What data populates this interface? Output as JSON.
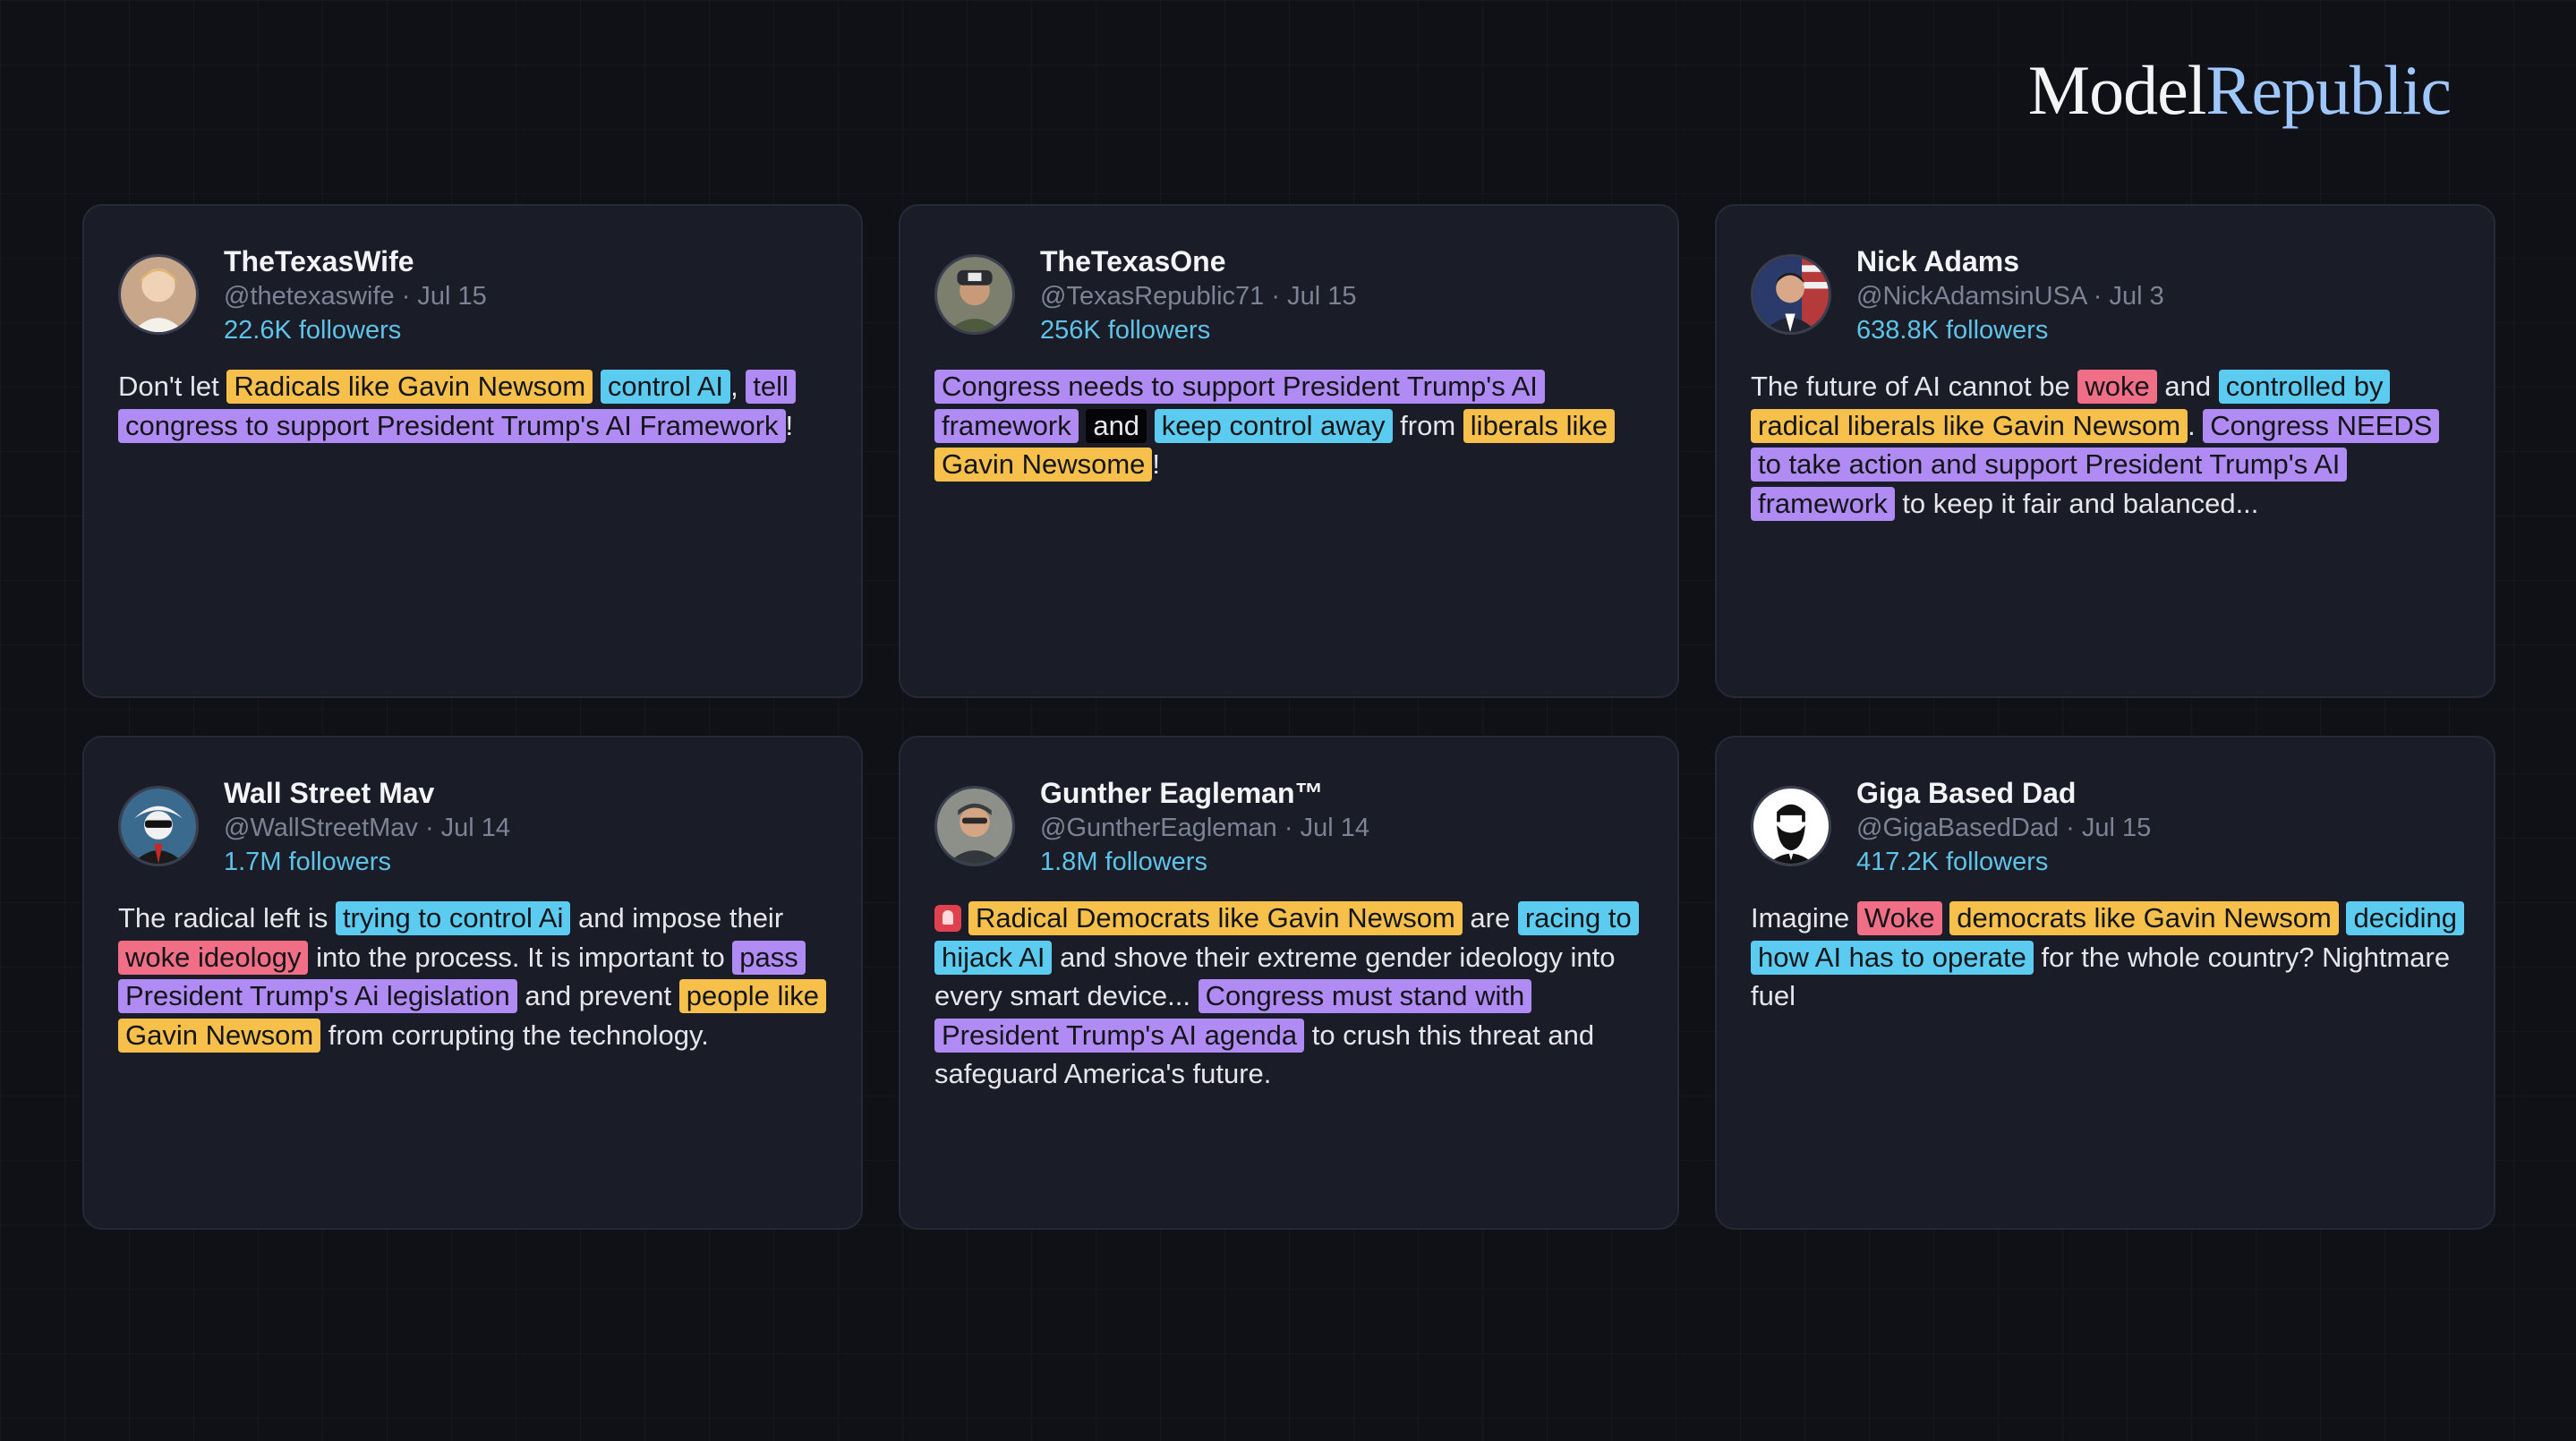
{
  "brand": {
    "part1": "Model",
    "part2": "Republic",
    "accent": "#9ec6ff"
  },
  "highlight_colors": {
    "yellow": "#f6c04a",
    "cyan": "#5ccbf0",
    "purple": "#b08bf3",
    "red": "#f06f86",
    "black": "#050507"
  },
  "posts": [
    {
      "name": "TheTexasWife",
      "handle_date": "@thetexaswife · Jul 15",
      "followers": "22.6K followers",
      "avatar_icon": "user-photo-icon",
      "segments": [
        {
          "text": "Don't let "
        },
        {
          "text": "Radicals like Gavin Newsom",
          "hl": "yellow"
        },
        {
          "text": " "
        },
        {
          "text": "control AI",
          "hl": "cyan"
        },
        {
          "text": ", "
        },
        {
          "text": "tell congress to support President Trump's AI Framework",
          "hl": "purple"
        },
        {
          "text": "!"
        }
      ]
    },
    {
      "name": "TheTexasOne",
      "handle_date": "@TexasRepublic71 · Jul 15",
      "followers": "256K followers",
      "avatar_icon": "user-photo-icon",
      "segments": [
        {
          "text": "Congress needs to support President Trump's AI framework",
          "hl": "purple"
        },
        {
          "text": " "
        },
        {
          "text": "and",
          "hl": "black"
        },
        {
          "text": " "
        },
        {
          "text": "keep control away",
          "hl": "cyan"
        },
        {
          "text": " from "
        },
        {
          "text": "liberals like Gavin Newsome",
          "hl": "yellow"
        },
        {
          "text": "!"
        }
      ]
    },
    {
      "name": "Nick Adams",
      "handle_date": "@NickAdamsinUSA · Jul 3",
      "followers": "638.8K followers",
      "avatar_icon": "user-photo-icon",
      "segments": [
        {
          "text": "The future of AI cannot be "
        },
        {
          "text": "woke",
          "hl": "red"
        },
        {
          "text": " and "
        },
        {
          "text": "controlled by",
          "hl": "cyan"
        },
        {
          "text": " "
        },
        {
          "text": "radical liberals like Gavin Newsom",
          "hl": "yellow"
        },
        {
          "text": ". "
        },
        {
          "text": "Congress NEEDS to take action and support President Trump's AI framework",
          "hl": "purple"
        },
        {
          "text": " to keep it fair and balanced..."
        }
      ]
    },
    {
      "name": "Wall Street Mav",
      "handle_date": "@WallStreetMav · Jul 14",
      "followers": "1.7M followers",
      "avatar_icon": "user-photo-icon",
      "segments": [
        {
          "text": "The radical left is "
        },
        {
          "text": "trying to control Ai",
          "hl": "cyan"
        },
        {
          "text": " and impose their "
        },
        {
          "text": "woke ideology",
          "hl": "red"
        },
        {
          "text": " into the process. It is important to "
        },
        {
          "text": "pass President Trump's Ai legislation",
          "hl": "purple"
        },
        {
          "text": " and prevent "
        },
        {
          "text": "people like Gavin Newsom",
          "hl": "yellow"
        },
        {
          "text": " from corrupting the technology."
        }
      ]
    },
    {
      "name": "Gunther Eagleman™",
      "handle_date": "@GuntherEagleman · Jul 14",
      "followers": "1.8M followers",
      "avatar_icon": "user-photo-icon",
      "leading_icon": "alarm-light-icon",
      "segments": [
        {
          "text": "Radical Democrats like Gavin Newsom",
          "hl": "yellow"
        },
        {
          "text": " are "
        },
        {
          "text": "racing to hijack AI",
          "hl": "cyan"
        },
        {
          "text": " and shove their extreme gender ideology into every smart device... "
        },
        {
          "text": "Congress must stand with President Trump's AI agenda",
          "hl": "purple"
        },
        {
          "text": " to crush this threat and safeguard America's future."
        }
      ]
    },
    {
      "name": "Giga Based Dad",
      "handle_date": "@GigaBasedDad · Jul 15",
      "followers": "417.2K followers",
      "avatar_icon": "bearded-man-icon",
      "segments": [
        {
          "text": "Imagine "
        },
        {
          "text": "Woke",
          "hl": "red"
        },
        {
          "text": " "
        },
        {
          "text": "democrats like Gavin Newsom",
          "hl": "yellow"
        },
        {
          "text": " "
        },
        {
          "text": "deciding how AI has to operate",
          "hl": "cyan"
        },
        {
          "text": " for the whole country? Nightmare fuel"
        }
      ]
    }
  ]
}
